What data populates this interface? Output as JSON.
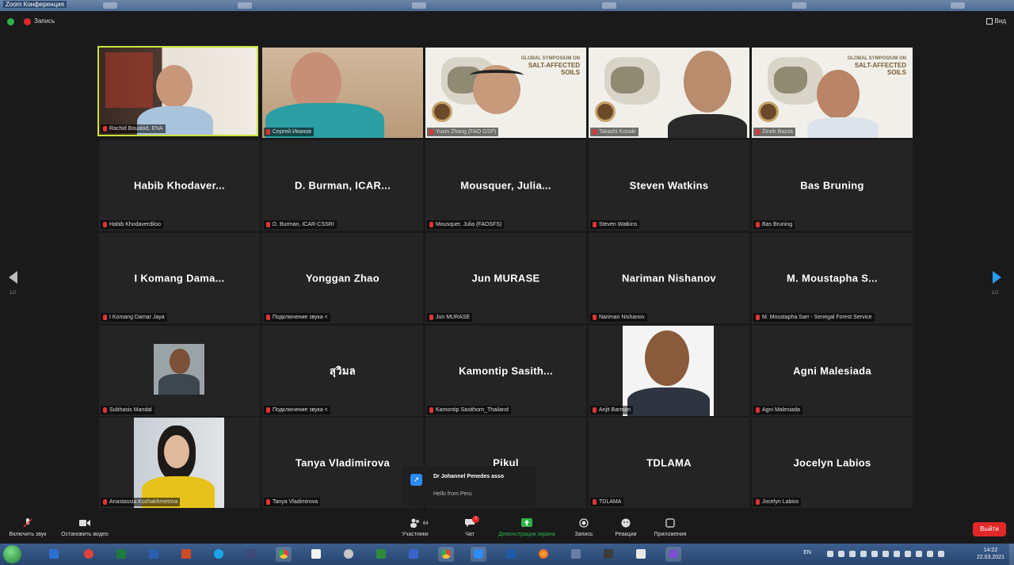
{
  "window": {
    "title": "Zoom Конференция"
  },
  "topbar": {
    "recording_label": "Запись",
    "view_label": "Вид"
  },
  "pager": {
    "left": "1/2",
    "right": "1/2"
  },
  "participants": {
    "r0": [
      {
        "label": "Rachid Bouabid, ENA",
        "type": "video"
      },
      {
        "label": "Сергей Иванов",
        "type": "video"
      },
      {
        "label": "Yuxin Zhang (FAO GSP)",
        "type": "slide"
      },
      {
        "label": "Takashi Kosaki",
        "type": "slide"
      },
      {
        "label": "Zineb Bazza",
        "type": "slide"
      }
    ],
    "r1": [
      {
        "name": "Habib Khodaver...",
        "label": "Habib Khodaverdiloo"
      },
      {
        "name": "D. Burman, ICAR...",
        "label": "D. Burman, ICAR-CSSRI"
      },
      {
        "name": "Mousquer, Julia...",
        "label": "Mousquer, Julia (FAOSFS)"
      },
      {
        "name": "Steven Watkins",
        "label": "Steven Watkins"
      },
      {
        "name": "Bas Bruning",
        "label": "Bas Bruning"
      }
    ],
    "r2": [
      {
        "name": "I Komang Dama...",
        "label": "I Komang Damar Jaya"
      },
      {
        "name": "Yonggan Zhao",
        "label": "Подключение звука <"
      },
      {
        "name": "Jun MURASE",
        "label": "Jun MURASE"
      },
      {
        "name": "Nariman Nishanov",
        "label": "Nariman Nishanov"
      },
      {
        "name": "M. Moustapha S...",
        "label": "M. Moustapha Sarr - Senegal Forest Service"
      }
    ],
    "r3": [
      {
        "name": "",
        "label": "Subhasis Mandal",
        "type": "photo"
      },
      {
        "name": "สุวิมล",
        "label": "Подключение звука <"
      },
      {
        "name": "Kamontip Sasith...",
        "label": "Kamontip Sasithorn_Thailand"
      },
      {
        "name": "",
        "label": "Arijit Barman",
        "type": "photo"
      },
      {
        "name": "Agni Malesiada",
        "label": "Agni Malesiada"
      }
    ],
    "r4": [
      {
        "name": "",
        "label": "Anastassia Kozhakhmetova",
        "type": "photo"
      },
      {
        "name": "Tanya Vladimirova",
        "label": "Tanya Vladimirova"
      },
      {
        "name": "Pikul",
        "label": ""
      },
      {
        "name": "TDLAMA",
        "label": "TDLAMA"
      },
      {
        "name": "Jocelyn Labios",
        "label": "Jocelyn Labios"
      }
    ]
  },
  "slide": {
    "line1": "GLOBAL SYMPOSIUM ON",
    "line2": "SALT-AFFECTED",
    "line3": "SOILS"
  },
  "notification": {
    "from": "Dr Johannel Penedes asso",
    "message": "Hello from Peru"
  },
  "toolbar": {
    "mute": "Включить звук",
    "video": "Остановить видео",
    "participants": "Участники",
    "participants_count": "64",
    "chat": "Чат",
    "chat_badge": "7",
    "share": "Демонстрация экрана",
    "record": "Запись",
    "reactions": "Реакции",
    "apps": "Приложения",
    "end": "Выйти"
  },
  "taskbar": {
    "lang": "EN",
    "time": "14:22",
    "date": "22.03.2021"
  }
}
